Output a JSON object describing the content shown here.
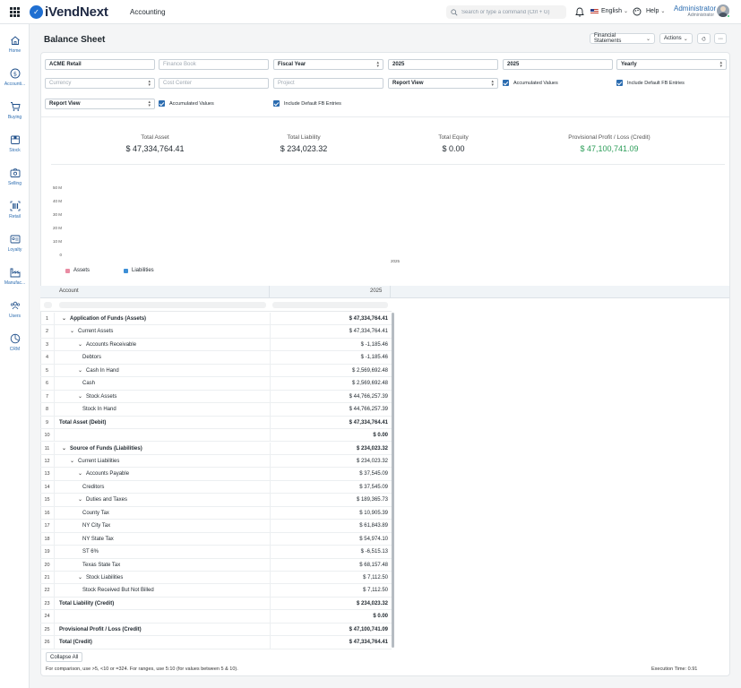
{
  "navbar": {
    "brand": "iVendNext",
    "module": "Accounting",
    "search_placeholder": "Search or type a command (Ctrl + G)",
    "language": "English",
    "help": "Help",
    "user_name": "Administrator",
    "user_role": "Administrator"
  },
  "sidebar": [
    {
      "label": "Home",
      "icon": "home-icon"
    },
    {
      "label": "Accounti...",
      "icon": "dollar-icon"
    },
    {
      "label": "Buying",
      "icon": "cart-icon"
    },
    {
      "label": "Stock",
      "icon": "box-icon"
    },
    {
      "label": "Selling",
      "icon": "selling-icon"
    },
    {
      "label": "Retail",
      "icon": "barcode-icon"
    },
    {
      "label": "Loyalty",
      "icon": "card-icon"
    },
    {
      "label": "Manufac...",
      "icon": "factory-icon"
    },
    {
      "label": "Users",
      "icon": "users-icon"
    },
    {
      "label": "CRM",
      "icon": "chart-pie-icon"
    }
  ],
  "page": {
    "title": "Balance Sheet",
    "financial_statements": "Financial Statements",
    "actions": "Actions"
  },
  "filters": {
    "company": "ACME Retail",
    "finance_book_placeholder": "Finance Book",
    "period_type": "Fiscal Year",
    "from_year": "2025",
    "to_year": "2025",
    "periodicity": "Yearly",
    "currency_placeholder": "Currency",
    "cost_center_placeholder": "Cost Center",
    "project_placeholder": "Project",
    "report_view": "Report View",
    "accumulated_values": "Accumulated Values",
    "include_default_fb": "Include Default FB Entries",
    "report_view_2": "Report View",
    "accumulated_values_2": "Accumulated Values",
    "include_default_fb_2": "Include Default FB Entries"
  },
  "summary": [
    {
      "label": "Total Asset",
      "value": "$ 47,334,764.41",
      "color": "#1f272e"
    },
    {
      "label": "Total Liability",
      "value": "$ 234,023.32",
      "color": "#1f272e"
    },
    {
      "label": "Total Equity",
      "value": "$ 0.00",
      "color": "#1f272e"
    },
    {
      "label": "Provisional Profit / Loss (Credit)",
      "value": "$ 47,100,741.09",
      "color": "#2e9e5a"
    }
  ],
  "chart_data": {
    "type": "bar",
    "categories": [
      "2025"
    ],
    "y_ticks": [
      "0",
      "10 M",
      "20 M",
      "30 M",
      "40 M",
      "50 M"
    ],
    "ylim": [
      0,
      50000000
    ],
    "series": [
      {
        "name": "Assets",
        "color": "#e98ca3",
        "values": [
          0
        ]
      },
      {
        "name": "Liabilities",
        "color": "#3d8fd6",
        "values": [
          0
        ]
      }
    ],
    "legend": "bottom-left"
  },
  "table": {
    "col_account": "Account",
    "col_2025": "2025",
    "rows": [
      {
        "n": "1",
        "label": "Application of Funds (Assets)",
        "amount": "$ 47,334,764.41",
        "indent": 0,
        "bold": true,
        "caret": true
      },
      {
        "n": "2",
        "label": "Current Assets",
        "amount": "$ 47,334,764.41",
        "indent": 1,
        "bold": false,
        "caret": true
      },
      {
        "n": "3",
        "label": "Accounts Receivable",
        "amount": "$ -1,185.46",
        "indent": 2,
        "bold": false,
        "caret": true
      },
      {
        "n": "4",
        "label": "Debtors",
        "amount": "$ -1,185.46",
        "indent": 3,
        "bold": false,
        "caret": false
      },
      {
        "n": "5",
        "label": "Cash In Hand",
        "amount": "$ 2,569,692.48",
        "indent": 2,
        "bold": false,
        "caret": true
      },
      {
        "n": "6",
        "label": "Cash",
        "amount": "$ 2,569,692.48",
        "indent": 3,
        "bold": false,
        "caret": false
      },
      {
        "n": "7",
        "label": "Stock Assets",
        "amount": "$ 44,766,257.39",
        "indent": 2,
        "bold": false,
        "caret": true
      },
      {
        "n": "8",
        "label": "Stock In Hand",
        "amount": "$ 44,766,257.39",
        "indent": 3,
        "bold": false,
        "caret": false
      },
      {
        "n": "9",
        "label": "Total Asset (Debit)",
        "amount": "$ 47,334,764.41",
        "indent": -1,
        "bold": true,
        "caret": false
      },
      {
        "n": "10",
        "label": "",
        "amount": "$ 0.00",
        "indent": -1,
        "bold": true,
        "caret": false
      },
      {
        "n": "11",
        "label": "Source of Funds (Liabilities)",
        "amount": "$ 234,023.32",
        "indent": 0,
        "bold": true,
        "caret": true
      },
      {
        "n": "12",
        "label": "Current Liabilities",
        "amount": "$ 234,023.32",
        "indent": 1,
        "bold": false,
        "caret": true
      },
      {
        "n": "13",
        "label": "Accounts Payable",
        "amount": "$ 37,545.09",
        "indent": 2,
        "bold": false,
        "caret": true
      },
      {
        "n": "14",
        "label": "Creditors",
        "amount": "$ 37,545.09",
        "indent": 3,
        "bold": false,
        "caret": false
      },
      {
        "n": "15",
        "label": "Duties and Taxes",
        "amount": "$ 189,365.73",
        "indent": 2,
        "bold": false,
        "caret": true
      },
      {
        "n": "16",
        "label": "County Tax",
        "amount": "$ 10,905.39",
        "indent": 3,
        "bold": false,
        "caret": false
      },
      {
        "n": "17",
        "label": "NY City Tax",
        "amount": "$ 61,843.89",
        "indent": 3,
        "bold": false,
        "caret": false
      },
      {
        "n": "18",
        "label": "NY State Tax",
        "amount": "$ 54,974.10",
        "indent": 3,
        "bold": false,
        "caret": false
      },
      {
        "n": "19",
        "label": "ST 6%",
        "amount": "$ -6,515.13",
        "indent": 3,
        "bold": false,
        "caret": false
      },
      {
        "n": "20",
        "label": "Texas State Tax",
        "amount": "$ 68,157.48",
        "indent": 3,
        "bold": false,
        "caret": false
      },
      {
        "n": "21",
        "label": "Stock Liabilities",
        "amount": "$ 7,112.50",
        "indent": 2,
        "bold": false,
        "caret": true
      },
      {
        "n": "22",
        "label": "Stock Received But Not Billed",
        "amount": "$ 7,112.50",
        "indent": 3,
        "bold": false,
        "caret": false
      },
      {
        "n": "23",
        "label": "Total Liability (Credit)",
        "amount": "$ 234,023.32",
        "indent": -1,
        "bold": true,
        "caret": false
      },
      {
        "n": "24",
        "label": "",
        "amount": "$ 0.00",
        "indent": -1,
        "bold": true,
        "caret": false
      },
      {
        "n": "25",
        "label": "Provisional Profit / Loss (Credit)",
        "amount": "$ 47,100,741.09",
        "indent": -1,
        "bold": true,
        "caret": false
      },
      {
        "n": "26",
        "label": "Total (Credit)",
        "amount": "$ 47,334,764.41",
        "indent": -1,
        "bold": true,
        "caret": false
      }
    ]
  },
  "footer": {
    "collapse_all": "Collapse All",
    "note": "For comparison, use >5, <10 or =324. For ranges, use 5:10 (for values between 5 & 10).",
    "execution_time": "Execution Time: 0.91"
  }
}
